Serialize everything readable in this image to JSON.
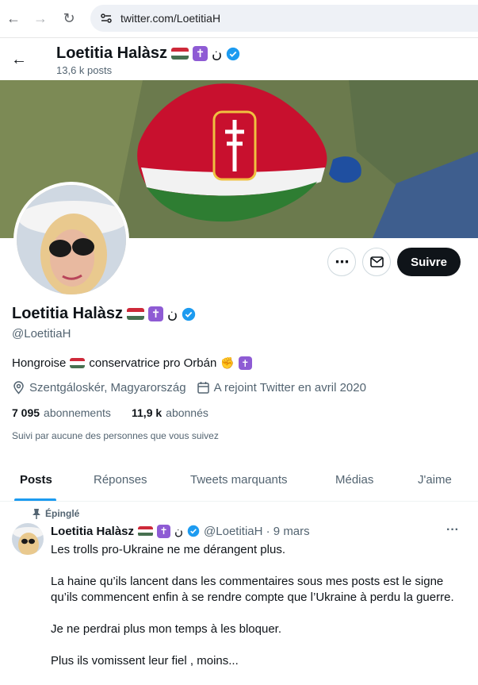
{
  "browser": {
    "url": "twitter.com/LoetitiaH",
    "back_icon": "arrow-left",
    "forward_icon": "arrow-right",
    "reload_icon": "reload"
  },
  "header": {
    "name": "Loetitia Halàsz",
    "arabic_letter": "ن",
    "posts_count": "13,6 k posts"
  },
  "profile": {
    "name": "Loetitia Halàsz",
    "arabic_letter": "ن",
    "handle": "@LoetitiaH",
    "bio_before_flag": "Hongroise",
    "bio_after_flag": "conservatrice pro Orbán",
    "location": "Szentgáloskér, Magyarország",
    "joined": "A rejoint Twitter en avril 2020",
    "following_count": "7 095",
    "following_label": "abonnements",
    "followers_count": "11,9 k",
    "followers_label": "abonnés",
    "followed_by": "Suivi par aucune des personnes que vous suivez",
    "follow_button": "Suivre"
  },
  "tabs": [
    "Posts",
    "Réponses",
    "Tweets marquants",
    "Médias",
    "J'aime"
  ],
  "pinned_tweet": {
    "pinned_label": "Épinglé",
    "author_name": "Loetitia Halàsz",
    "arabic_letter": "ن",
    "handle_date": "@LoetitiaH · 9 mars",
    "more": "···",
    "paragraphs": [
      "Les trolls pro-Ukraine ne me dérangent plus.",
      "La haine qu’ils lancent dans les commentaires sous mes posts est le signe qu’ils commencent enfin à se rendre compte que l’Ukraine à perdu la guerre.",
      "Je ne perdrai plus mon temps à  les bloquer.",
      "Plus ils vomissent leur fiel , moins..."
    ]
  },
  "colors": {
    "accent": "#1d9bf0",
    "text": "#0f1419",
    "secondary": "#536471",
    "flag_red": "#ce2939",
    "flag_green": "#477050",
    "cross_purple": "#8e5bd4"
  }
}
